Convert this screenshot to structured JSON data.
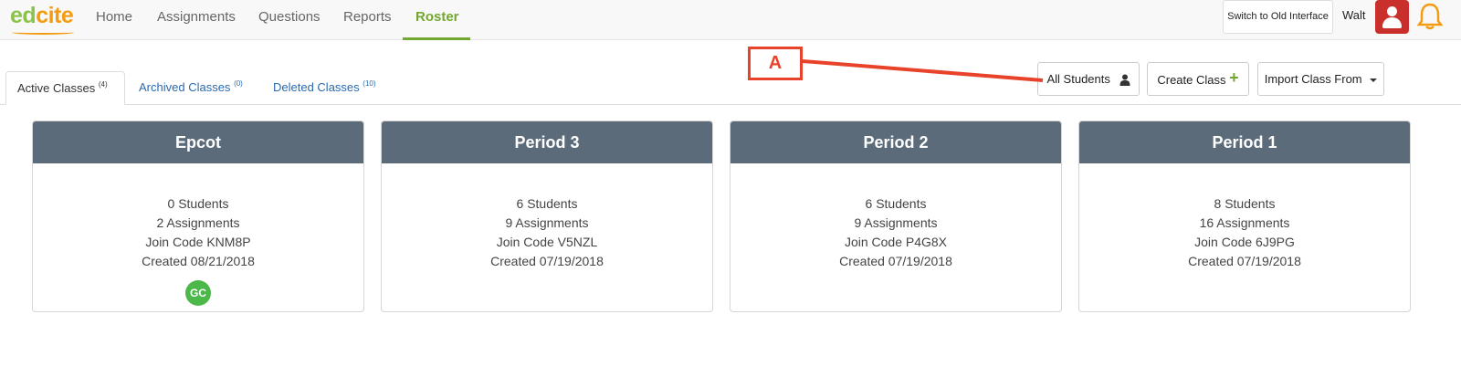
{
  "nav": {
    "logo": {
      "part1": "ed",
      "part2": "cite"
    },
    "items": [
      "Home",
      "Assignments",
      "Questions",
      "Reports",
      "Roster"
    ],
    "active": "Roster",
    "switch_label": "Switch to Old Interface",
    "user_name": "Walt"
  },
  "tabs": [
    {
      "label": "Active Classes",
      "count": "(4)"
    },
    {
      "label": "Archived Classes",
      "count": "(0)"
    },
    {
      "label": "Deleted Classes",
      "count": "(10)"
    }
  ],
  "actions": {
    "all_students": "All Students",
    "create_class": "Create Class",
    "import_class": "Import Class From"
  },
  "annotation": {
    "label": "A",
    "color": "#e8432a"
  },
  "classes": [
    {
      "name": "Epcot",
      "students": "0 Students",
      "assignments": "2 Assignments",
      "join_code": "Join Code KNM8P",
      "created": "Created 08/21/2018",
      "badge": "GC"
    },
    {
      "name": "Period 3",
      "students": "6 Students",
      "assignments": "9 Assignments",
      "join_code": "Join Code V5NZL",
      "created": "Created 07/19/2018"
    },
    {
      "name": "Period 2",
      "students": "6 Students",
      "assignments": "9 Assignments",
      "join_code": "Join Code P4G8X",
      "created": "Created 07/19/2018"
    },
    {
      "name": "Period 1",
      "students": "8 Students",
      "assignments": "16 Assignments",
      "join_code": "Join Code 6J9PG",
      "created": "Created 07/19/2018"
    }
  ],
  "colors": {
    "brand_green": "#72a82f",
    "card_header": "#5b6b7a",
    "link_blue": "#2a6ab0",
    "avatar_red": "#c9302c",
    "badge_green": "#4cb84a"
  },
  "icons": {
    "all_students": "user-icon",
    "create_class": "plus-icon",
    "import_class": "caret-down-icon",
    "notifications": "bell-icon",
    "avatar": "user-avatar-icon"
  }
}
